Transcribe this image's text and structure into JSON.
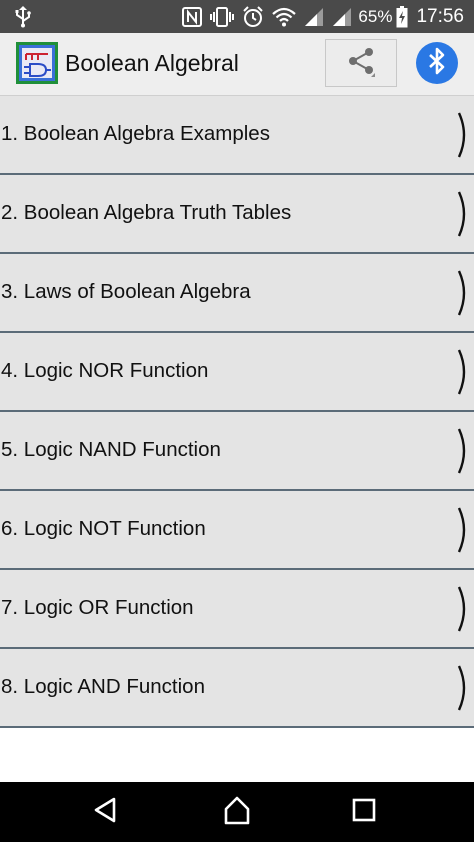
{
  "status_bar": {
    "battery_percent": "65%",
    "time": "17:56",
    "icons": [
      "usb-icon",
      "nfc-icon",
      "vibrate-icon",
      "alarm-icon",
      "wifi-icon",
      "signal-icon",
      "signal-icon-2",
      "battery-icon"
    ]
  },
  "app_bar": {
    "title": "Boolean Algebral",
    "logo_icon": "logic-gate-app-icon",
    "share_icon": "share-icon",
    "bluetooth_icon": "bluetooth-icon",
    "colors": {
      "bluetooth_bg": "#2a78e4",
      "bar_bg": "#eeeeee"
    }
  },
  "menu": {
    "items": [
      {
        "label": "1. Boolean Algebra Examples"
      },
      {
        "label": "2. Boolean Algebra Truth Tables"
      },
      {
        "label": "3. Laws of Boolean Algebra"
      },
      {
        "label": "4. Logic NOR Function"
      },
      {
        "label": "5. Logic NAND Function"
      },
      {
        "label": "6. Logic NOT Function"
      },
      {
        "label": "7. Logic OR Function"
      },
      {
        "label": "8. Logic AND Function"
      }
    ],
    "colors": {
      "item_bg": "#e4e4e4",
      "divider": "#5b6b78"
    }
  },
  "nav_bar": {
    "icons": [
      "back-icon",
      "home-icon",
      "recents-icon"
    ]
  }
}
